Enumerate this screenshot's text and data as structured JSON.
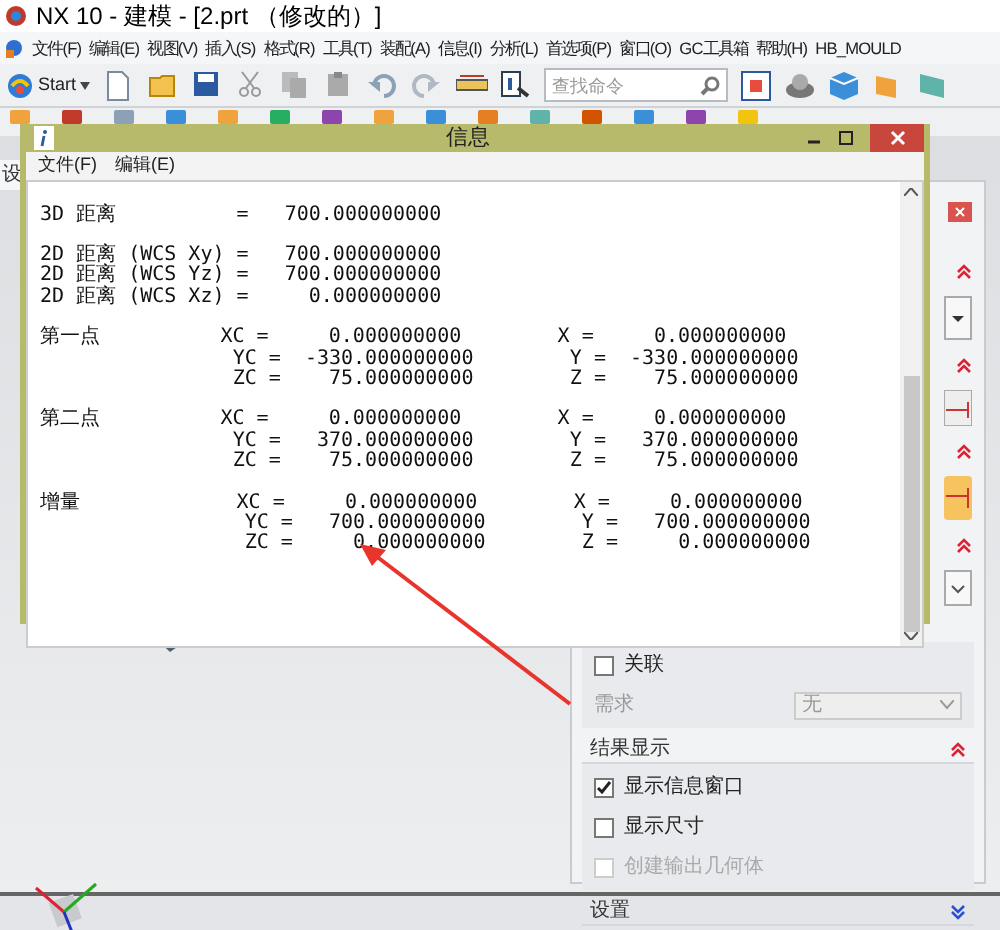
{
  "app_title": "NX 10 - 建模 - [2.prt （修改的）]",
  "menu": [
    "文件(F)",
    "编辑(E)",
    "视图(V)",
    "插入(S)",
    "格式(R)",
    "工具(T)",
    "装配(A)",
    "信息(I)",
    "分析(L)",
    "首选项(P)",
    "窗口(O)",
    "GC工具箱",
    "帮助(H)",
    "HB_MOULD"
  ],
  "toolbar": {
    "start": "Start",
    "search": {
      "placeholder": "查找命令"
    }
  },
  "side_tab": "设",
  "info_window": {
    "title": "信息",
    "menu": [
      "文件(F)",
      "编辑(E)"
    ],
    "groups": [
      [
        "3D 距离          =   700.000000000"
      ],
      [
        "2D 距离 (WCS Xy) =   700.000000000",
        "2D 距离 (WCS Yz) =   700.000000000",
        "2D 距离 (WCS Xz) =     0.000000000"
      ],
      [
        "第一点          XC =     0.000000000        X =     0.000000000",
        "                YC =  -330.000000000        Y =  -330.000000000",
        "                ZC =    75.000000000        Z =    75.000000000"
      ],
      [
        "第二点          XC =     0.000000000        X =     0.000000000",
        "                YC =   370.000000000        Y =   370.000000000",
        "                ZC =    75.000000000        Z =    75.000000000"
      ],
      [
        "增量             XC =     0.000000000        X =     0.000000000",
        "                 YC =   700.000000000        Y =   700.000000000",
        "                 ZC =     0.000000000        Z =     0.000000000"
      ]
    ]
  },
  "panel": {
    "related": {
      "label": "关联",
      "checked": false
    },
    "requirement": {
      "label": "需求",
      "value": "无",
      "disabled": true
    },
    "sections": [
      {
        "title": "结果显示",
        "expanded": true,
        "options": [
          {
            "label": "显示信息窗口",
            "checked": true,
            "disabled": false
          },
          {
            "label": "显示尺寸",
            "checked": false,
            "disabled": false
          },
          {
            "label": "创建输出几何体",
            "checked": false,
            "disabled": true
          }
        ]
      },
      {
        "title": "设置",
        "expanded": false
      }
    ]
  }
}
